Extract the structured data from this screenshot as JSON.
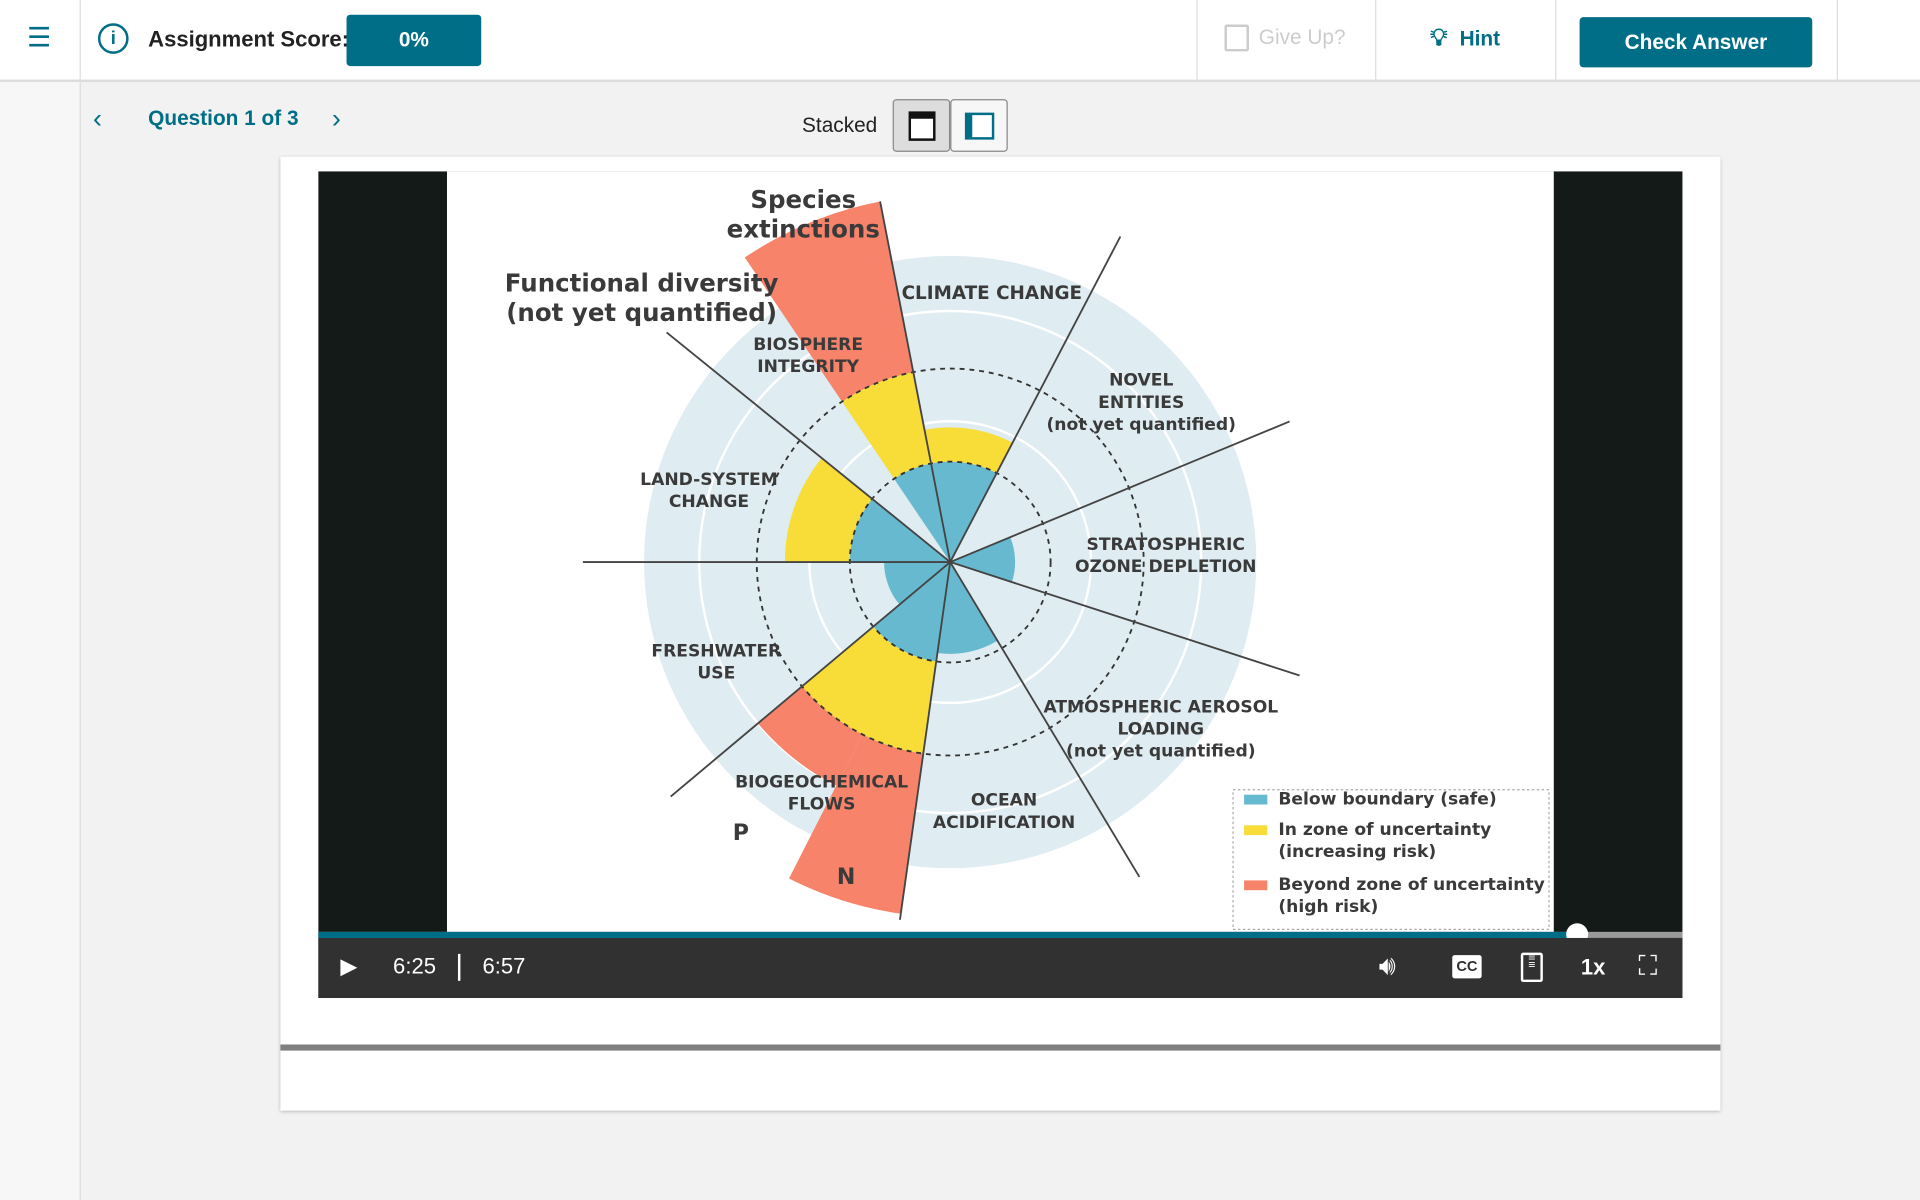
{
  "header": {
    "score_label": "Assignment Score:",
    "score_value": "0%",
    "give_up_label": "Give Up?",
    "hint_label": "Hint",
    "check_answer_label": "Check Answer"
  },
  "nav": {
    "question_label": "Question 1 of 3",
    "layout_label": "Stacked"
  },
  "video": {
    "current_time": "6:25",
    "duration": "6:57",
    "progress_fraction": 0.923,
    "speed": "1x",
    "diagram": {
      "species_extinctions": [
        "Species",
        "extinctions"
      ],
      "functional_diversity": [
        "Functional diversity",
        "(not yet quantified)"
      ],
      "climate_change": [
        "CLIMATE CHANGE"
      ],
      "biosphere_integrity": [
        "BIOSPHERE",
        "INTEGRITY"
      ],
      "novel_entities": [
        "NOVEL",
        "ENTITIES",
        "(not yet quantified)"
      ],
      "land_system_change": [
        "LAND-SYSTEM",
        "CHANGE"
      ],
      "stratospheric_ozone": [
        "STRATOSPHERIC",
        "OZONE DEPLETION"
      ],
      "freshwater_use": [
        "FRESHWATER",
        "USE"
      ],
      "atmospheric_aerosol": [
        "ATMOSPHERIC AEROSOL",
        "LOADING",
        "(not yet quantified)"
      ],
      "biogeochemical_flows": [
        "BIOGEOCHEMICAL",
        "FLOWS"
      ],
      "ocean_acidification": [
        "OCEAN",
        "ACIDIFICATION"
      ],
      "p_label": "P",
      "n_label": "N",
      "legend": [
        {
          "label": [
            "Below boundary (safe)"
          ],
          "color": "#67b9d0"
        },
        {
          "label": [
            "In zone of uncertainty",
            "(increasing risk)"
          ],
          "color": "#f8dc38"
        },
        {
          "label": [
            "Beyond zone of uncertainty",
            "(high risk)"
          ],
          "color": "#f6836a"
        }
      ]
    }
  },
  "colors": {
    "accent": "#006e87",
    "safe": "#67b9d0",
    "uncertain": "#f8dc38",
    "high_risk": "#f6836a"
  }
}
